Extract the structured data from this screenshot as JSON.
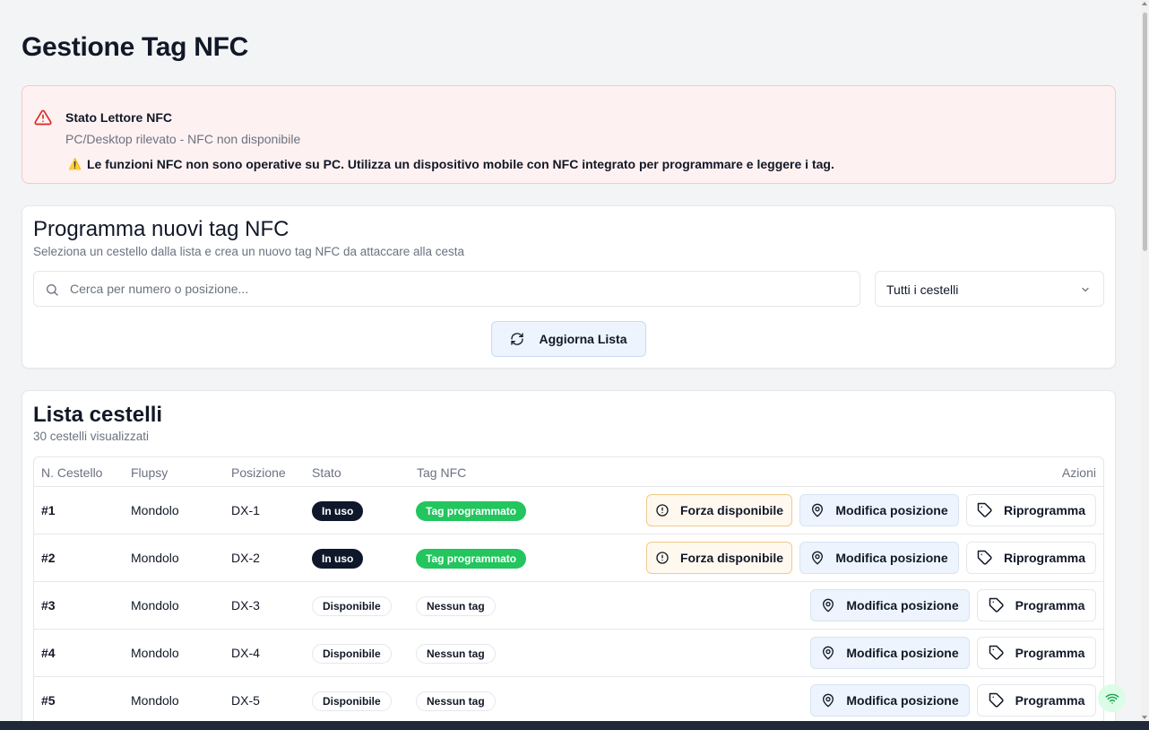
{
  "page": {
    "title": "Gestione Tag NFC"
  },
  "alert": {
    "title": "Stato Lettore NFC",
    "subtitle": "PC/Desktop rilevato - NFC non disponibile",
    "emoji": "⚠️",
    "message": "Le funzioni NFC non sono operative su PC. Utilizza un dispositivo mobile con NFC integrato per programmare e leggere i tag."
  },
  "program": {
    "title": "Programma nuovi tag NFC",
    "description": "Seleziona un cestello dalla lista e crea un nuovo tag NFC da attaccare alla cesta",
    "search_placeholder": "Cerca per numero o posizione...",
    "search_value": "",
    "filter_selected": "Tutti i cestelli",
    "refresh_label": "Aggiorna Lista"
  },
  "list": {
    "title": "Lista cestelli",
    "count_text": "30 cestelli visualizzati",
    "headers": {
      "number": "N. Cestello",
      "flupsy": "Flupsy",
      "position": "Posizione",
      "status": "Stato",
      "tag": "Tag NFC",
      "actions": "Azioni"
    },
    "rows": [
      {
        "number": "#1",
        "flupsy": "Mondolo",
        "position": "DX-1",
        "status": "In uso",
        "tag": "Tag programmato",
        "actions": [
          "Forza disponibile",
          "Modifica posizione",
          "Riprogramma"
        ]
      },
      {
        "number": "#2",
        "flupsy": "Mondolo",
        "position": "DX-2",
        "status": "In uso",
        "tag": "Tag programmato",
        "actions": [
          "Forza disponibile",
          "Modifica posizione",
          "Riprogramma"
        ]
      },
      {
        "number": "#3",
        "flupsy": "Mondolo",
        "position": "DX-3",
        "status": "Disponibile",
        "tag": "Nessun tag",
        "actions": [
          "Modifica posizione",
          "Programma"
        ]
      },
      {
        "number": "#4",
        "flupsy": "Mondolo",
        "position": "DX-4",
        "status": "Disponibile",
        "tag": "Nessun tag",
        "actions": [
          "Modifica posizione",
          "Programma"
        ]
      },
      {
        "number": "#5",
        "flupsy": "Mondolo",
        "position": "DX-5",
        "status": "Disponibile",
        "tag": "Nessun tag",
        "actions": [
          "Modifica posizione",
          "Programma"
        ]
      }
    ]
  },
  "colors": {
    "in_use_badge": "#0f172a",
    "tag_badge": "#22c55e",
    "alert_bg": "#fef1f1",
    "alert_icon": "#dc2626",
    "force_button_bg": "#fff8ef",
    "move_button_bg": "#edf4fd"
  },
  "icons": {
    "alert": "warning-triangle-icon",
    "search": "search-icon",
    "select": "chevron-down-icon",
    "refresh": "refresh-icon",
    "force": "alert-circle-icon",
    "move": "map-pin-icon",
    "program": "tag-icon",
    "fab": "wifi-icon"
  }
}
